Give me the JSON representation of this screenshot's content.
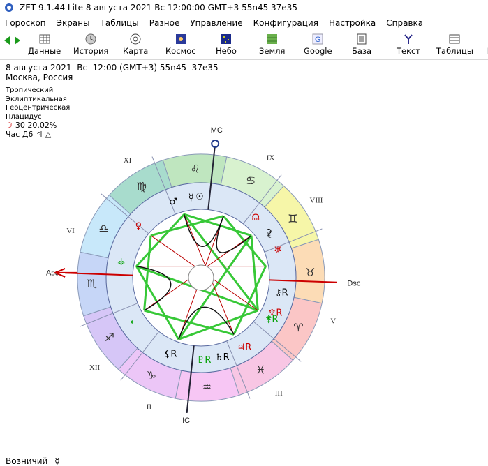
{
  "window": {
    "title": "ZET 9.1.44 Lite    8 августа 2021  Вс  12:00:00 GMT+3 55n45  37e35"
  },
  "menu": [
    "Гороскоп",
    "Экраны",
    "Таблицы",
    "Разное",
    "Управление",
    "Конфигурация",
    "Настройка",
    "Справка"
  ],
  "toolbar": {
    "buttons": [
      {
        "label": "Данные",
        "icon": "grid-icon"
      },
      {
        "label": "История",
        "icon": "history-icon"
      },
      {
        "label": "Карта",
        "icon": "chart-wheel-icon"
      },
      {
        "label": "Космос",
        "icon": "cosmos-icon"
      },
      {
        "label": "Небо",
        "icon": "sky-icon"
      },
      {
        "label": "Земля",
        "icon": "earth-icon"
      },
      {
        "label": "Google",
        "icon": "google-icon"
      },
      {
        "label": "База",
        "icon": "database-icon"
      },
      {
        "label": "Текст",
        "icon": "text-icon"
      },
      {
        "label": "Таблицы",
        "icon": "tables-icon"
      },
      {
        "label": "F",
        "icon": "more-icon"
      }
    ]
  },
  "info": {
    "line1": "8 августа 2021  Вс  12:00 (GMT+3) 55n45  37e35",
    "line2": "Москва, Россия"
  },
  "props": {
    "zodiac": "Тропический",
    "coords": "Эклиптикальная",
    "center": "Геоцентрическая",
    "houses": "Плацидус",
    "moon_phase": "30 20.02%",
    "moon_glyph": "☽",
    "hour": "Час Д6",
    "hour_glyphs": "♃  △"
  },
  "chart": {
    "angles": {
      "mc": "MC",
      "ic": "IC",
      "asc": "Asc",
      "dsc": "Dsc"
    },
    "houses": [
      "XI",
      "IX",
      "VIII",
      "VI",
      "V",
      "III",
      "II",
      "XII"
    ],
    "signs": [
      "♌",
      "♋",
      "♊",
      "♉",
      "♈",
      "♓",
      "♒",
      "♑",
      "♐",
      "♏",
      "♎",
      "♍"
    ],
    "sign_colors": [
      "#bfe6bf",
      "#d8f2cf",
      "#f6f6a8",
      "#fcdcb6",
      "#fbc6c6",
      "#f8c6e4",
      "#f7c6f4",
      "#ecc6f7",
      "#d6c6f7",
      "#c6d6f7",
      "#c8e8fa",
      "#a8dccd"
    ],
    "planets": [
      {
        "glyph": "☿",
        "color": "#000000"
      },
      {
        "glyph": "☉",
        "color": "#000000"
      },
      {
        "glyph": "♂",
        "color": "#000000"
      },
      {
        "glyph": "♀",
        "color": "#cc0000"
      },
      {
        "glyph": "☊",
        "color": "#cc0000"
      },
      {
        "glyph": "⚳",
        "color": "#000000"
      },
      {
        "glyph": "☾",
        "color": "#000000"
      },
      {
        "glyph": "♅",
        "color": "#cc0000"
      },
      {
        "glyph": "⚷R",
        "color": "#000000"
      },
      {
        "glyph": "♆R",
        "color": "#cc0000"
      },
      {
        "glyph": "⚵R",
        "color": "#00a000"
      },
      {
        "glyph": "♃R",
        "color": "#cc0000"
      },
      {
        "glyph": "♄R",
        "color": "#000000"
      },
      {
        "glyph": "♇R",
        "color": "#00a000"
      },
      {
        "glyph": "⚸R",
        "color": "#000000"
      },
      {
        "glyph": "⚹",
        "color": "#00a000"
      },
      {
        "glyph": "⚶",
        "color": "#00a000"
      }
    ]
  },
  "footer": {
    "label": "Возничий",
    "glyph": "☿"
  }
}
